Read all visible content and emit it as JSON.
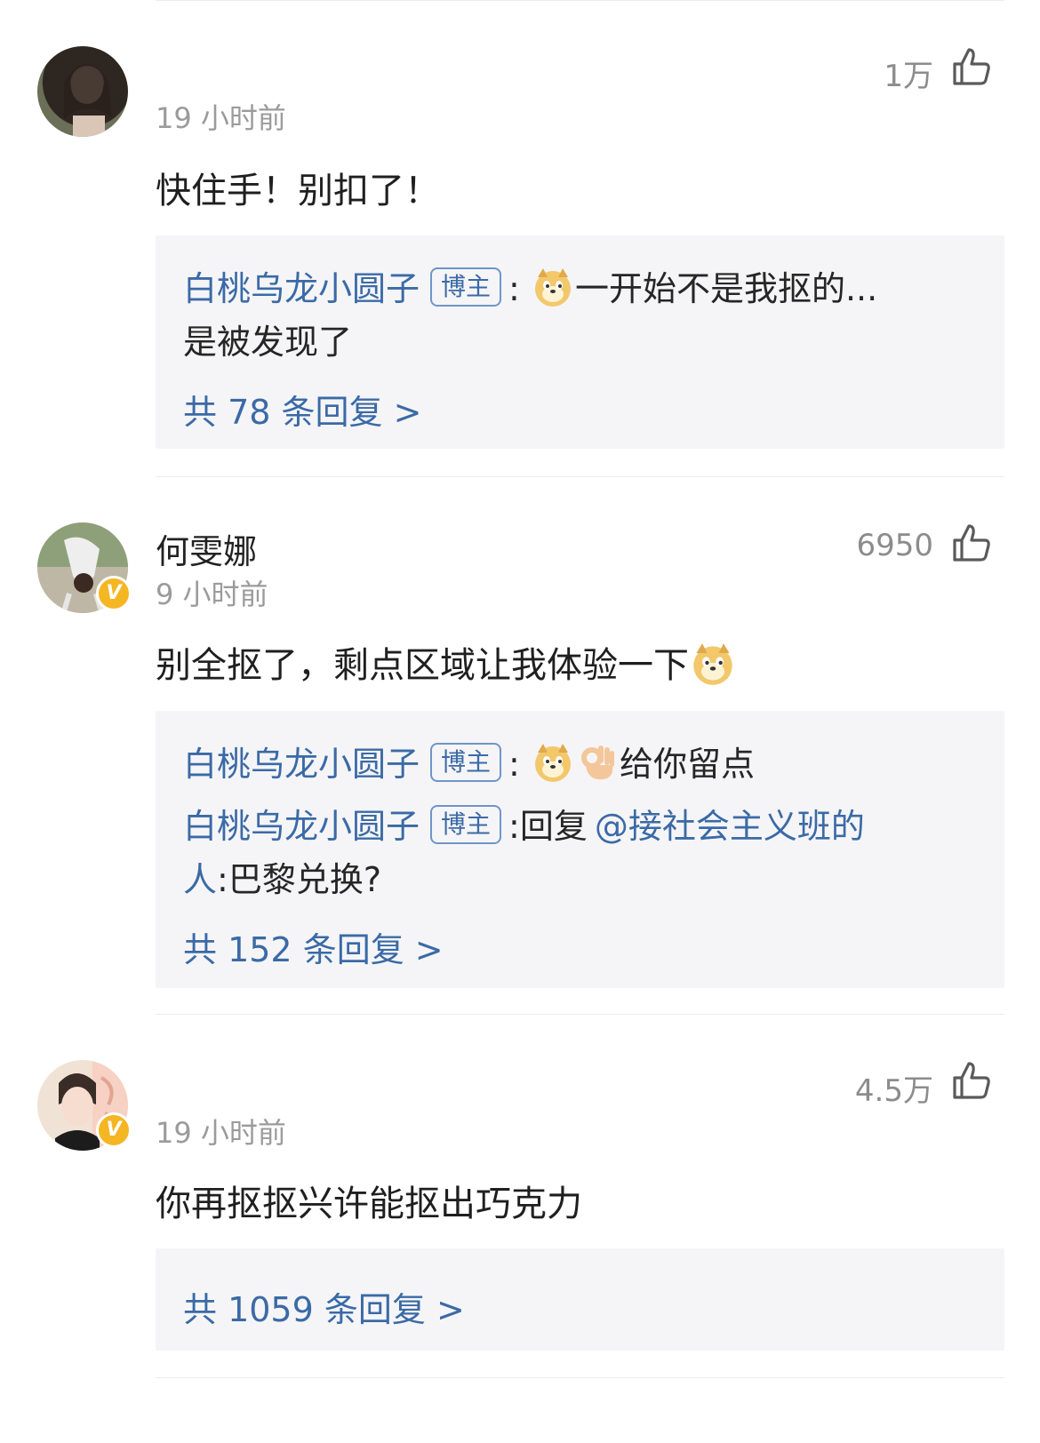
{
  "comments": [
    {
      "username": "",
      "time": "19 小时前",
      "likes": "1万",
      "body": "快住手！别扣了！",
      "verified": false,
      "replies": [
        {
          "author": "白桃乌龙小圆子",
          "badge": "博主",
          "line1": "一开始不是我抠的...",
          "line2": "是被发现了"
        }
      ],
      "more": "共 78 条回复 >"
    },
    {
      "username": "何雯娜",
      "time": "9 小时前",
      "likes": "6950",
      "body": "别全抠了，剩点区域让我体验一下",
      "verified": true,
      "replies": [
        {
          "author": "白桃乌龙小圆子",
          "badge": "博主",
          "line1": "给你留点"
        },
        {
          "author": "白桃乌龙小圆子",
          "badge": "博主",
          "prefix": "回复",
          "mention": "@接社会主义班的",
          "mention_cont": "人",
          "line2": ":巴黎兑换?"
        }
      ],
      "more": "共 152 条回复 >"
    },
    {
      "username": "",
      "time": "19 小时前",
      "likes": "4.5万",
      "body": "你再抠抠兴许能抠出巧克力",
      "verified": true,
      "replies": [],
      "more": "共 1059 条回复 >"
    }
  ],
  "icons": {
    "like": "thumbs-up-outline-icon",
    "verified": "verified-v-badge-icon",
    "doge": "doge-emoji-icon",
    "ok_hand": "ok-hand-emoji-icon"
  },
  "colors": {
    "link": "#3b6aa6",
    "muted": "#9b9b9b",
    "reply_bg": "#f5f5f7",
    "verified": "#f5b623"
  },
  "verified_mark": "V"
}
